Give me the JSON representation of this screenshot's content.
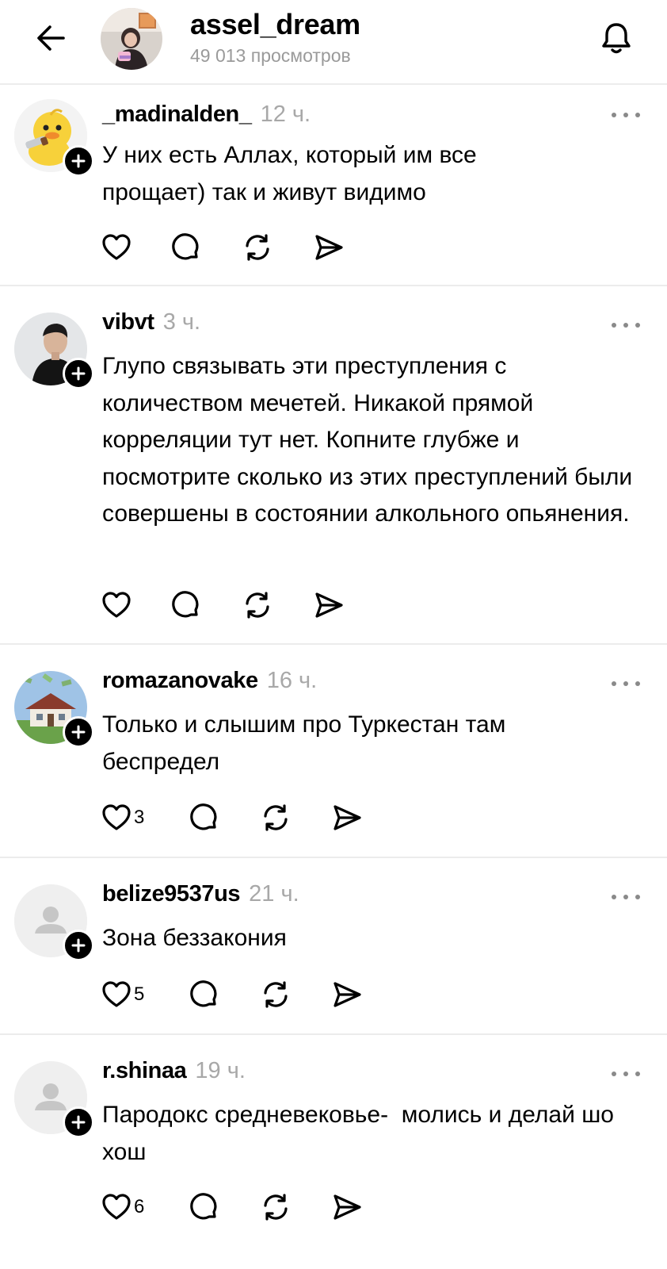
{
  "header": {
    "back_icon": "arrow-left-icon",
    "title": "assel_dream",
    "views": "49 013 просмотров",
    "bell_icon": "bell-icon"
  },
  "comments": [
    {
      "username": "_madinalden_",
      "time": "12 ч.",
      "text": "У них есть Аллах, который им все прощает) так и живут видимо",
      "likes": "",
      "avatar": "duck-avatar"
    },
    {
      "username": "vibvt",
      "time": "3 ч.",
      "text": "Глупо связывать эти преступления с количеством мечетей. Никакой прямой корреляции тут нет. Копните глубже и посмотрите сколько из этих преступлений были совершены в состоянии алкольного опьянения.",
      "likes": "",
      "avatar": "photo-avatar"
    },
    {
      "username": "romazanovake",
      "time": "16 ч.",
      "text": "Только и слышим про Туркестан там беспредел",
      "likes": "3",
      "avatar": "house-avatar"
    },
    {
      "username": "belize9537us",
      "time": "21 ч.",
      "text": "Зона беззакония",
      "likes": "5",
      "avatar": "default-avatar"
    },
    {
      "username": "r.shinaa",
      "time": "19 ч.",
      "text": "Пародокс средневековье-  молись и делай шо хош",
      "likes": "6",
      "avatar": "default-avatar"
    }
  ],
  "colors": {
    "text": "#000000",
    "muted": "#a8a8a8",
    "divider": "#ececec",
    "badge": "#000000"
  }
}
